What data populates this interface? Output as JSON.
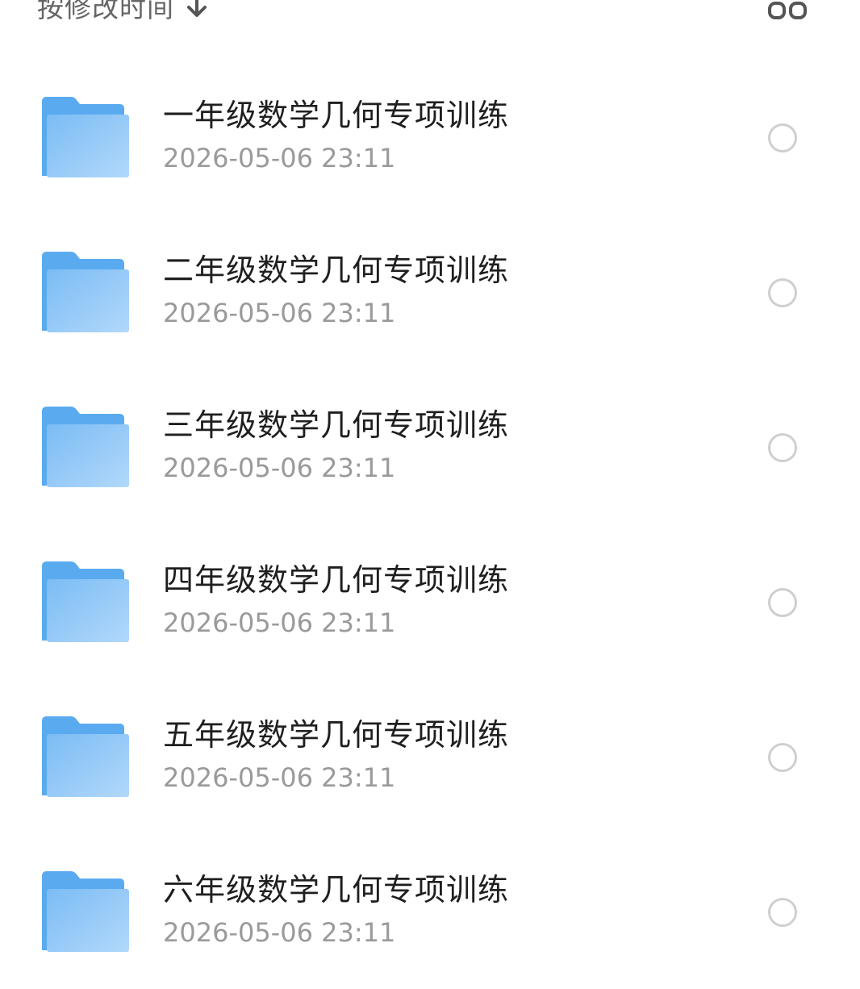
{
  "sort": {
    "label": "按修改时间",
    "direction_icon": "arrow-down-icon"
  },
  "view_toggle": {
    "icon": "grid-view-icon"
  },
  "colors": {
    "folder_back": "#5aaaf0",
    "folder_front_start": "#7bbcf4",
    "folder_front_end": "#b2d8fb",
    "title_text": "#1f1f1f",
    "date_text": "#9a9a9a",
    "radio_border": "#cfcfcf"
  },
  "files": [
    {
      "name": "一年级数学几何专项训练",
      "date": "2026-05-06 23:11",
      "icon": "folder-icon"
    },
    {
      "name": "二年级数学几何专项训练",
      "date": "2026-05-06 23:11",
      "icon": "folder-icon"
    },
    {
      "name": "三年级数学几何专项训练",
      "date": "2026-05-06 23:11",
      "icon": "folder-icon"
    },
    {
      "name": "四年级数学几何专项训练",
      "date": "2026-05-06 23:11",
      "icon": "folder-icon"
    },
    {
      "name": "五年级数学几何专项训练",
      "date": "2026-05-06 23:11",
      "icon": "folder-icon"
    },
    {
      "name": "六年级数学几何专项训练",
      "date": "2026-05-06 23:11",
      "icon": "folder-icon"
    }
  ]
}
